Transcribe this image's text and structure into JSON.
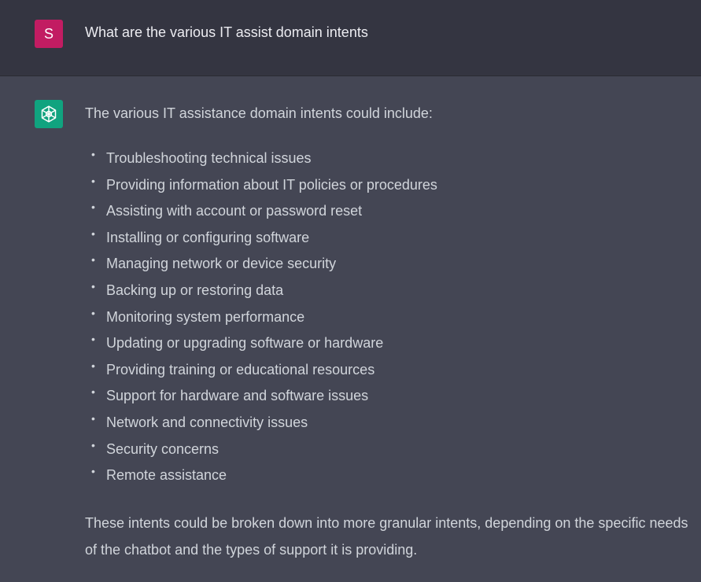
{
  "user": {
    "avatar_letter": "S",
    "message": "What are the various IT assist domain intents"
  },
  "assistant": {
    "avatar_icon": "openai-logo-icon",
    "intro": "The various IT assistance domain intents could include:",
    "bullet_char": "•",
    "intents": [
      "Troubleshooting technical issues",
      "Providing information about IT policies or procedures",
      "Assisting with account or password reset",
      "Installing or configuring software",
      "Managing network or device security",
      "Backing up or restoring data",
      "Monitoring system performance",
      "Updating or upgrading software or hardware",
      "Providing training or educational resources",
      "Support for hardware and software issues",
      "Network and connectivity issues",
      "Security concerns",
      "Remote assistance"
    ],
    "closing": "These intents could be broken down into more granular intents, depending on the specific needs of the chatbot and the types of support it is providing."
  },
  "colors": {
    "user_row_bg": "#343541",
    "assistant_row_bg": "#444654",
    "user_avatar_bg": "#c21c62",
    "assistant_avatar_bg": "#10a37f",
    "text": "#d1d5db"
  }
}
